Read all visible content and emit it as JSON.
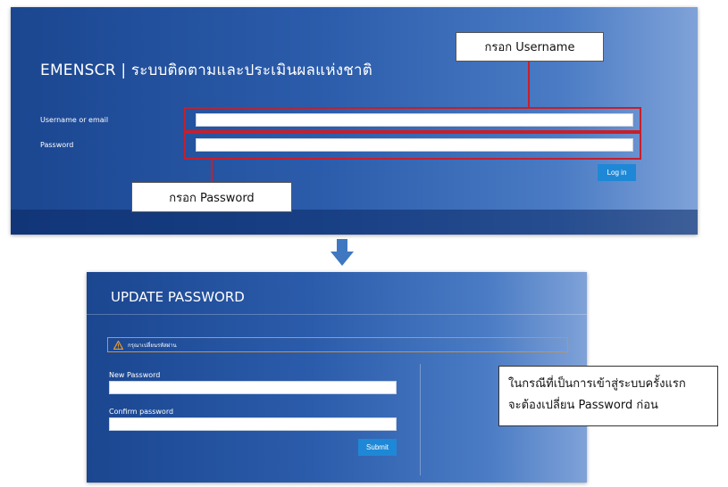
{
  "login_screen": {
    "title": "EMENSCR | ระบบติดตามและประเมินผลแห่งชาติ",
    "username_label": "Username or email",
    "username_value": "",
    "password_label": "Password",
    "password_value": "",
    "login_button": "Log in",
    "callout_username": "กรอก Username",
    "callout_password": "กรอก Password"
  },
  "update_screen": {
    "title": "UPDATE PASSWORD",
    "warning_text": "กรุณาเปลี่ยนรหัสผ่าน",
    "new_password_label": "New Password",
    "new_password_value": "",
    "confirm_password_label": "Confirm password",
    "confirm_password_value": "",
    "submit_button": "Submit"
  },
  "note": {
    "line1": "ในกรณีที่เป็นการเข้าสู่ระบบครั้งแรก",
    "line2": "จะต้องเปลี่ยน Password ก่อน"
  },
  "icons": {
    "flow_arrow": "arrow-down-icon",
    "warning": "warning-icon"
  },
  "colors": {
    "highlight": "#c61f2b",
    "button": "#1e88d6",
    "warning_border": "#d7922d",
    "arrow": "#3f78c0"
  }
}
